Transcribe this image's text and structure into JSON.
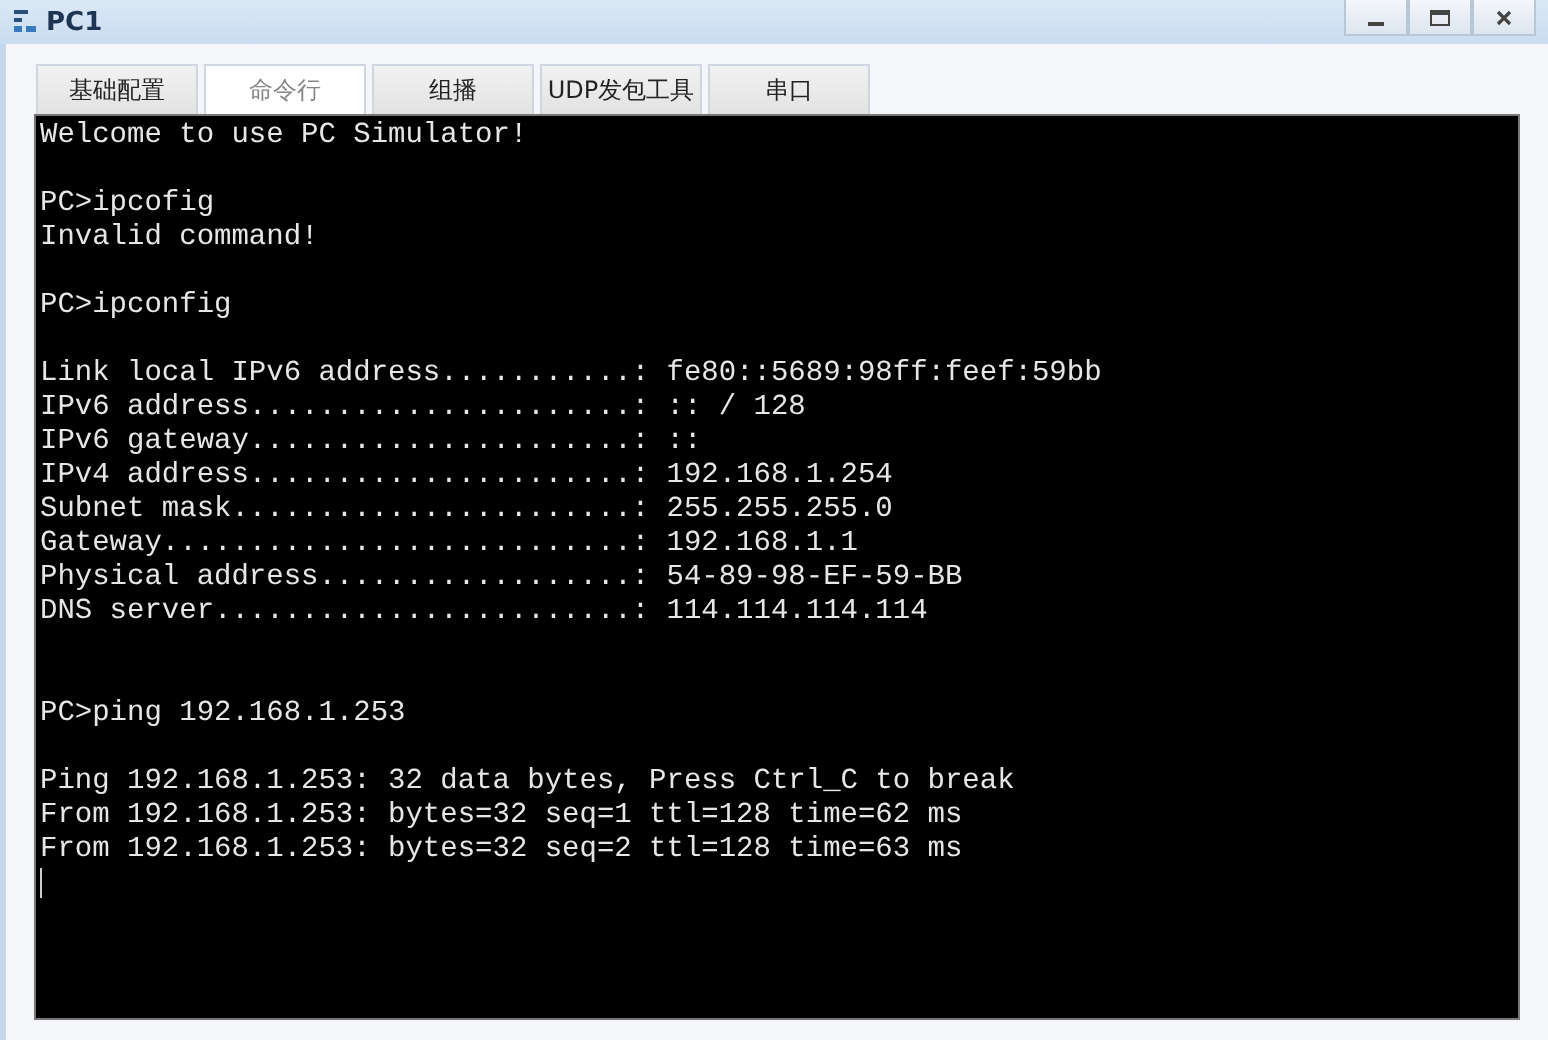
{
  "window": {
    "title": "PC1"
  },
  "tabs": [
    {
      "label": "基础配置",
      "selected": false
    },
    {
      "label": "命令行",
      "selected": true
    },
    {
      "label": "组播",
      "selected": false
    },
    {
      "label": "UDP发包工具",
      "selected": false
    },
    {
      "label": "串口",
      "selected": false
    }
  ],
  "terminal": {
    "lines": [
      {
        "kind": "text",
        "text": "Welcome to use PC Simulator!"
      },
      {
        "kind": "blank"
      },
      {
        "kind": "text",
        "text": "PC>ipcofig"
      },
      {
        "kind": "text",
        "text": "Invalid command!"
      },
      {
        "kind": "blank"
      },
      {
        "kind": "text",
        "text": "PC>ipconfig"
      },
      {
        "kind": "blank"
      },
      {
        "kind": "text",
        "text": "Link local IPv6 address...........: fe80::5689:98ff:feef:59bb"
      },
      {
        "kind": "text",
        "text": "IPv6 address......................: :: / 128"
      },
      {
        "kind": "text",
        "text": "IPv6 gateway......................: ::"
      },
      {
        "kind": "text",
        "text": "IPv4 address......................: 192.168.1.254"
      },
      {
        "kind": "text",
        "text": "Subnet mask.......................: 255.255.255.0"
      },
      {
        "kind": "text",
        "text": "Gateway...........................: 192.168.1.1"
      },
      {
        "kind": "text",
        "text": "Physical address..................: 54-89-98-EF-59-BB"
      },
      {
        "kind": "text",
        "text": "DNS server........................: 114.114.114.114"
      },
      {
        "kind": "blank"
      },
      {
        "kind": "blank"
      },
      {
        "kind": "text",
        "text": "PC>ping 192.168.1.253"
      },
      {
        "kind": "blank"
      },
      {
        "kind": "text",
        "text": "Ping 192.168.1.253: 32 data bytes, Press Ctrl_C to break"
      },
      {
        "kind": "text",
        "text": "From 192.168.1.253: bytes=32 seq=1 ttl=128 time=62 ms"
      },
      {
        "kind": "text",
        "text": "From 192.168.1.253: bytes=32 seq=2 ttl=128 time=63 ms"
      },
      {
        "kind": "cursor"
      }
    ]
  }
}
